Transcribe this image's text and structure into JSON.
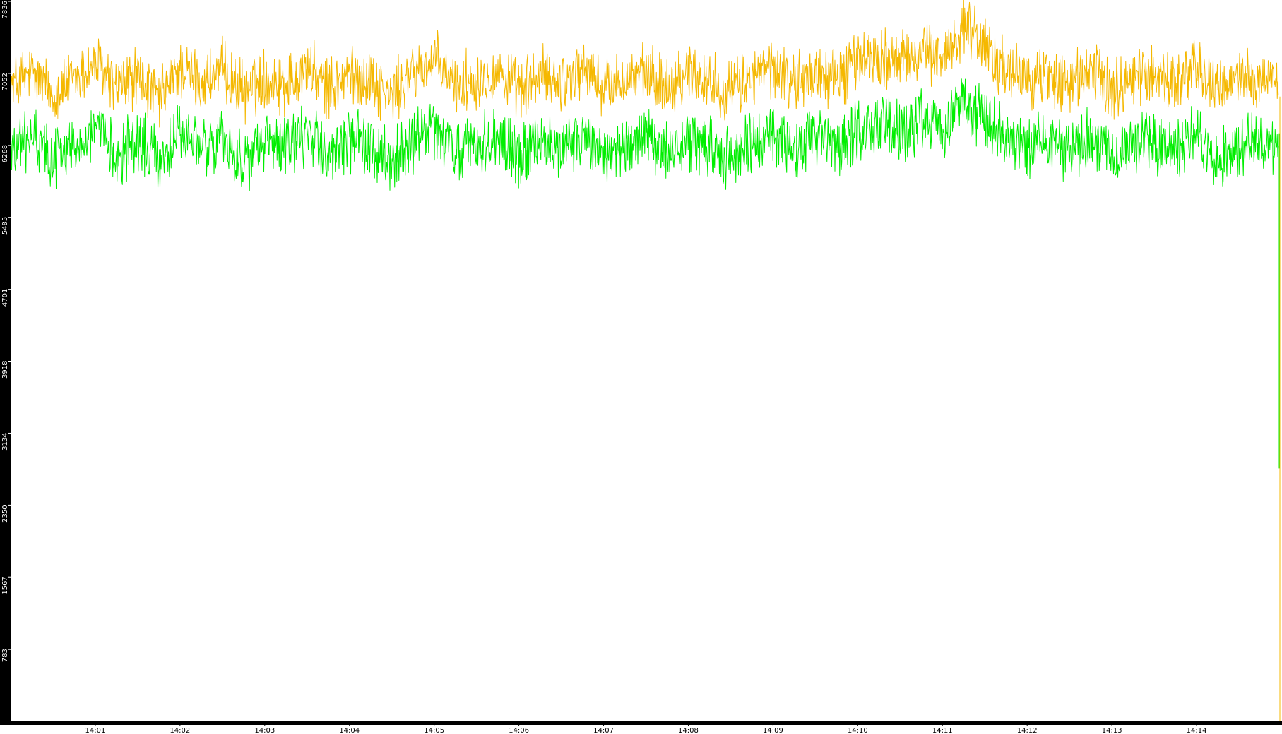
{
  "chart_data": {
    "type": "line",
    "title": "",
    "xlabel": "",
    "ylabel": "",
    "x_range": [
      "14:00",
      "14:15"
    ],
    "x_ticks": [
      "14:01",
      "14:02",
      "14:03",
      "14:04",
      "14:05",
      "14:06",
      "14:07",
      "14:08",
      "14:09",
      "14:10",
      "14:11",
      "14:12",
      "14:13",
      "14:14"
    ],
    "ylim": [
      0,
      7836
    ],
    "y_ticks": [
      "0",
      "783",
      "1567",
      "2350",
      "3134",
      "3918",
      "4701",
      "5485",
      "6268",
      "7052",
      "7836"
    ],
    "grid": false,
    "legend": "none",
    "series": [
      {
        "color": "#f5b800",
        "sample_interval_seconds": 15,
        "values": [
          6900,
          7050,
          6820,
          6980,
          7150,
          6890,
          7020,
          6760,
          7100,
          6950,
          7080,
          6840,
          7010,
          6930,
          7120,
          6870,
          7040,
          6980,
          6800,
          7060,
          7180,
          6920,
          6990,
          7070,
          6860,
          7030,
          6950,
          7110,
          6890,
          7000,
          7040,
          6910,
          7080,
          6970,
          6850,
          7020,
          7100,
          6940,
          7060,
          6990,
          7190,
          7250,
          7160,
          7300,
          7210,
          7580,
          7360,
          7050,
          6990,
          7030,
          6920,
          7090,
          6880,
          7010,
          7060,
          6940,
          7130,
          6830,
          7020,
          6950,
          7070,
          6900,
          7000,
          6960,
          7080,
          6990,
          7150,
          6870,
          7040,
          6930,
          6820,
          7050,
          6980,
          7110,
          6900,
          7060,
          6790,
          7020,
          6950,
          7070,
          6890,
          6960,
          7030,
          6930,
          7080,
          6870,
          6980,
          7060,
          6920,
          7010
        ]
      },
      {
        "color": "#00ee00",
        "sample_interval_seconds": 15,
        "values": [
          6200,
          6350,
          6150,
          6280,
          6420,
          6180,
          6300,
          6120,
          6380,
          6250,
          6330,
          6080,
          6290,
          6210,
          6400,
          6160,
          6310,
          6270,
          6090,
          6320,
          6430,
          6200,
          6260,
          6340,
          6140,
          6290,
          6220,
          6360,
          6170,
          6240,
          6310,
          6180,
          6330,
          6250,
          6120,
          6280,
          6370,
          6200,
          6320,
          6260,
          6450,
          6520,
          6410,
          6580,
          6470,
          6700,
          6580,
          6330,
          6260,
          6300,
          6190,
          6350,
          6150,
          6280,
          6330,
          6210,
          6390,
          6100,
          6280,
          6220,
          6340,
          6170,
          6260,
          6230,
          6350,
          6250,
          6420,
          6050,
          5850,
          6190,
          6090,
          6310,
          6240,
          6380,
          6170,
          6320,
          6060,
          6280,
          6210,
          6330,
          6150,
          6230,
          6290,
          6200,
          6350,
          6140,
          6250,
          6320,
          6180,
          6270
        ]
      }
    ]
  }
}
